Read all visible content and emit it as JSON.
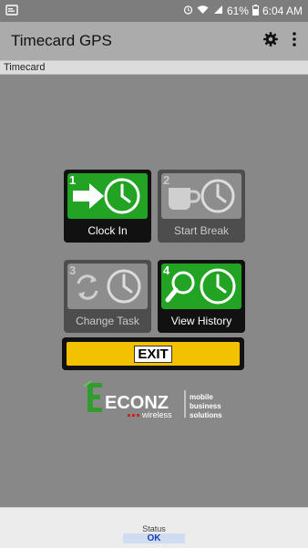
{
  "status_bar": {
    "battery": "61%",
    "time": "6:04 AM"
  },
  "app_bar": {
    "title": "Timecard GPS",
    "settings_icon": "gear-icon",
    "overflow_icon": "more-vert-icon"
  },
  "section": {
    "title": "Timecard"
  },
  "tiles": [
    {
      "number": "1",
      "label": "Clock In",
      "icon": "arrow-clock-icon",
      "enabled": true
    },
    {
      "number": "2",
      "label": "Start Break",
      "icon": "cup-clock-icon",
      "enabled": false
    },
    {
      "number": "3",
      "label": "Change Task",
      "icon": "refresh-clock-icon",
      "enabled": false
    },
    {
      "number": "4",
      "label": "View History",
      "icon": "magnifier-clock-icon",
      "enabled": true
    }
  ],
  "exit": {
    "label": "EXIT"
  },
  "logo": {
    "brand": "ECONZ",
    "sub": "wireless",
    "tagline_lines": [
      "mobile",
      "business",
      "solutions"
    ]
  },
  "footer": {
    "status_label": "Status",
    "status_value": "OK"
  },
  "colors": {
    "accent_green": "#23a323",
    "exit_yellow": "#f2c200",
    "background": "#888888"
  }
}
